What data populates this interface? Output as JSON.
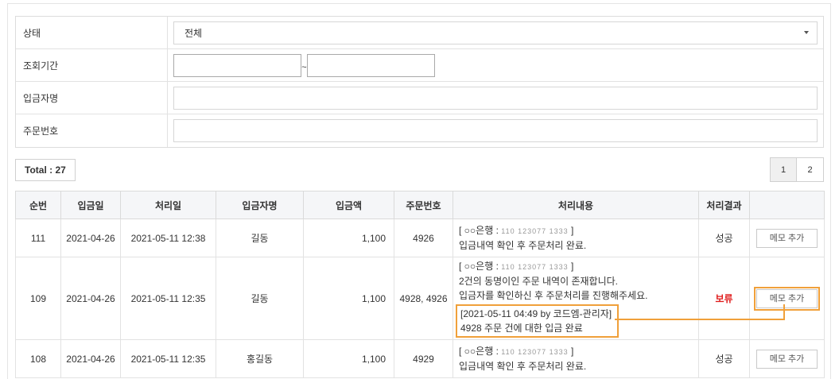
{
  "filter": {
    "status_label": "상태",
    "status_value": "전체",
    "period_label": "조회기간",
    "period_separator": "~",
    "depositor_label": "입금자명",
    "order_no_label": "주문번호"
  },
  "total_label": "Total : 27",
  "pagination": [
    "1",
    "2"
  ],
  "table": {
    "headers": [
      "순번",
      "입금일",
      "처리일",
      "입금자명",
      "입금액",
      "주문번호",
      "처리내용",
      "처리결과",
      ""
    ],
    "rows": [
      {
        "seq": "111",
        "deposit_date": "2021-04-26",
        "process_date": "2021-05-11 12:38",
        "depositor": "길동",
        "amount": "1,100",
        "order_no": "4926",
        "content_bank": "[ ○○은행 :",
        "content_account": "110 123077 1333",
        "content_bank_end": "]",
        "content_lines": [
          "입금내역 확인 후 주문처리 완료."
        ],
        "result": "성공",
        "memo_button": "메모 추가"
      },
      {
        "seq": "109",
        "deposit_date": "2021-04-26",
        "process_date": "2021-05-11 12:35",
        "depositor": "길동",
        "amount": "1,100",
        "order_no": "4928, 4926",
        "content_bank": "[ ○○은행 :",
        "content_account": "110 123077 1333",
        "content_bank_end": "]",
        "content_lines": [
          "2건의 동명이인 주문 내역이 존재합니다.",
          "입금자를 확인하신 후 주문처리를 진행해주세요."
        ],
        "memo_header": "[2021-05-11 04:49 by 코드엠-관리자]",
        "memo_text": "4928 주문 건에 대한 입금 완료",
        "result": "보류",
        "memo_button": "메모 추가"
      },
      {
        "seq": "108",
        "deposit_date": "2021-04-26",
        "process_date": "2021-05-11 12:35",
        "depositor": "홍길동",
        "amount": "1,100",
        "order_no": "4929",
        "content_bank": "[ ○○은행 :",
        "content_account": "110 123077 1333",
        "content_bank_end": "]",
        "content_lines": [
          "입금내역 확인 후 주문처리 완료."
        ],
        "result": "성공",
        "memo_button": "메모 추가"
      }
    ]
  },
  "colors": {
    "highlight": "#f0a03a",
    "hold": "#e01e1e",
    "header_bg": "#f5f6f8"
  }
}
